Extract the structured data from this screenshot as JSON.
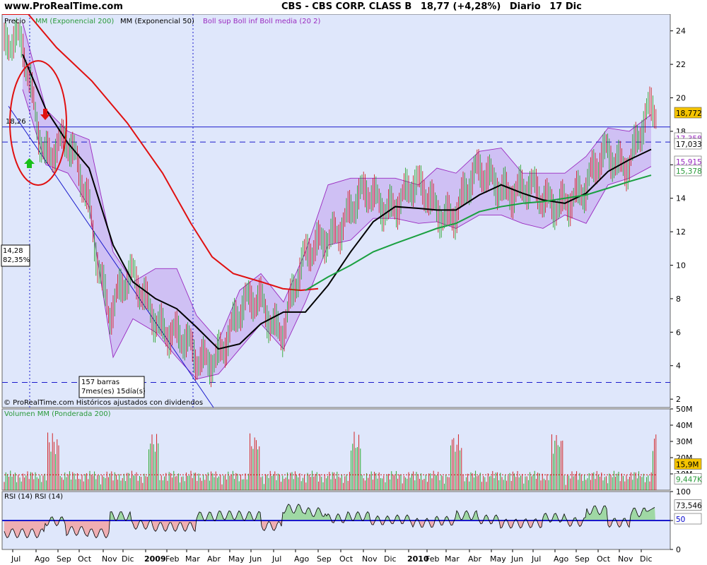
{
  "header": {
    "site": "www.ProRealTime.com",
    "ticker": "CBS - CBS CORP. CLASS B",
    "price_change": "18,77 (+4,28%)",
    "period": "Diario",
    "date": "17 Dic"
  },
  "price_panel": {
    "legend": [
      {
        "text": "Precio",
        "color": "#000000"
      },
      {
        "text": "MM (Exponencial 200)",
        "color": "#2a9a3a"
      },
      {
        "text": "MM (Exponencial 50)",
        "color": "#000000"
      },
      {
        "text": "Boll sup Boll inf Boll media (20 2)",
        "color": "#9a2ac0"
      }
    ],
    "y_ticks": [
      "24",
      "22",
      "20",
      "18",
      "16",
      "14",
      "12",
      "10",
      "8",
      "6",
      "4",
      "2"
    ],
    "y_tick_values": [
      24,
      22,
      20,
      18,
      16,
      14,
      12,
      10,
      8,
      6,
      4,
      2
    ],
    "badges": [
      {
        "text": "18,772",
        "value": 18.77,
        "bg": "#f5c400",
        "fg": "#000000"
      },
      {
        "text": "17,358",
        "value": 17.358,
        "bg": "#ffffff",
        "fg": "#9a2ac0"
      },
      {
        "text": "17,033",
        "value": 16.92,
        "bg": "#ffffff",
        "fg": "#000000"
      },
      {
        "text": "15,915",
        "value": 15.915,
        "bg": "#ffffff",
        "fg": "#9a2ac0"
      },
      {
        "text": "15,378",
        "value": 15.378,
        "bg": "#ffffff",
        "fg": "#2a9a3a"
      }
    ],
    "level_label": "18,26",
    "annot_box1": [
      "14,28",
      "82,35%"
    ],
    "annot_box2": [
      "157 barras",
      "7mes(es) 15día(s)"
    ],
    "footer": "© ProRealTime.com  Históricos ajustados con dividendos"
  },
  "volume_panel": {
    "legend": "Volumen  MM (Ponderada 200)",
    "y_ticks": [
      "50M",
      "40M",
      "30M",
      "20M",
      "10M"
    ],
    "y_tick_values": [
      50,
      40,
      30,
      20,
      10
    ],
    "badges": [
      {
        "text": "15,9M",
        "value": 15.9,
        "bg": "#f5c400",
        "fg": "#000000"
      },
      {
        "text": "9,447K",
        "value": 9.447,
        "bg": "#ffffff",
        "fg": "#2a9a3a"
      }
    ]
  },
  "rsi_panel": {
    "legend": "RSI (14)   RSI (14)",
    "y_ticks": [
      "100",
      "50",
      "0"
    ],
    "y_tick_values": [
      100,
      50,
      0
    ],
    "badges": [
      {
        "text": "73,546",
        "value": 73.546,
        "bg": "#ffffff",
        "fg": "#000000"
      },
      {
        "text": "50",
        "value": 50,
        "bg": "#ffffff",
        "fg": "#0000cc"
      }
    ]
  },
  "x_axis": {
    "labels": [
      "Jul",
      "Ago",
      "Sep",
      "Oct",
      "Nov",
      "Dic",
      "2009",
      "Feb",
      "Mar",
      "Abr",
      "May",
      "Jun",
      "Jul",
      "Ago",
      "Sep",
      "Oct",
      "Nov",
      "Dic",
      "2010",
      "Feb",
      "Mar",
      "Abr",
      "May",
      "Jun",
      "Jul",
      "Ago",
      "Sep",
      "Oct",
      "Nov",
      "Dic"
    ],
    "bold": [
      "2009",
      "2010"
    ]
  },
  "chart_data": {
    "type": "line",
    "title": "CBS - CBS CORP. CLASS B",
    "ylabel": "",
    "xlabel": "",
    "ylim": [
      1.5,
      25
    ],
    "x": [
      "Jul",
      "Ago",
      "Sep",
      "Oct",
      "Nov",
      "Dic",
      "2009",
      "Feb",
      "Mar",
      "Abr",
      "May",
      "Jun",
      "Jul",
      "Ago",
      "Sep",
      "Oct",
      "Nov",
      "Dic",
      "2010",
      "Feb",
      "Mar",
      "Abr",
      "May",
      "Jun",
      "Jul",
      "Ago",
      "Sep",
      "Oct",
      "Nov",
      "Dic"
    ],
    "series": [
      {
        "name": "Precio",
        "color": "#000000",
        "values": [
          22.8,
          17.2,
          17.0,
          14.0,
          7.5,
          8.8,
          7.6,
          5.8,
          4.0,
          5.2,
          6.7,
          8.0,
          6.4,
          9.8,
          12.2,
          12.8,
          14.0,
          14.0,
          14.3,
          13.6,
          13.5,
          15.0,
          15.3,
          14.4,
          13.6,
          14.4,
          14.0,
          17.0,
          16.4,
          18.77
        ]
      },
      {
        "name": "MM (Exponencial 50)",
        "color": "#000000",
        "values": [
          22.6,
          19.3,
          17.3,
          15.8,
          11.2,
          9.0,
          8.0,
          7.4,
          6.3,
          5.0,
          5.3,
          6.5,
          7.2,
          7.2,
          8.8,
          10.8,
          12.6,
          13.5,
          13.4,
          13.3,
          13.3,
          14.2,
          14.8,
          14.3,
          13.9,
          13.7,
          14.3,
          15.6,
          16.3,
          16.92
        ]
      },
      {
        "name": "MM (Exponencial 200)",
        "color": "#2a9a3a",
        "values": [
          null,
          null,
          null,
          null,
          null,
          null,
          null,
          null,
          null,
          null,
          null,
          null,
          null,
          8.5,
          9.3,
          10.0,
          10.8,
          11.3,
          11.8,
          12.2,
          12.5,
          13.2,
          13.5,
          13.7,
          13.8,
          14.0,
          14.2,
          14.6,
          15.0,
          15.378
        ]
      },
      {
        "name": "Boll sup",
        "color": "#9a2ac0",
        "values": [
          24.5,
          19.3,
          18.0,
          17.5,
          10.8,
          9.0,
          9.8,
          9.8,
          7.0,
          5.5,
          8.5,
          9.5,
          7.8,
          10.8,
          14.8,
          15.2,
          15.2,
          15.2,
          14.8,
          15.8,
          15.5,
          16.8,
          17.0,
          15.5,
          15.5,
          15.5,
          16.5,
          18.2,
          18.0,
          19.0
        ]
      },
      {
        "name": "Boll inf",
        "color": "#9a2ac0",
        "values": [
          20.5,
          16.0,
          15.5,
          13.5,
          4.5,
          6.8,
          6.0,
          4.5,
          3.2,
          3.5,
          5.0,
          6.5,
          5.0,
          7.8,
          11.2,
          11.5,
          12.8,
          12.8,
          12.5,
          12.6,
          12.2,
          13.0,
          13.0,
          12.5,
          12.2,
          13.0,
          12.5,
          14.8,
          15.2,
          15.9
        ]
      }
    ],
    "resistance_level": 18.26,
    "support_level": 3.0,
    "dashed_level": 17.36,
    "volume": {
      "unit": "M",
      "ylim": [
        0,
        50
      ],
      "ma_value": 9.447,
      "last_value": 15.9
    },
    "rsi": {
      "ylim": [
        0,
        100
      ],
      "reference": 50,
      "last_value": 73.546
    }
  }
}
